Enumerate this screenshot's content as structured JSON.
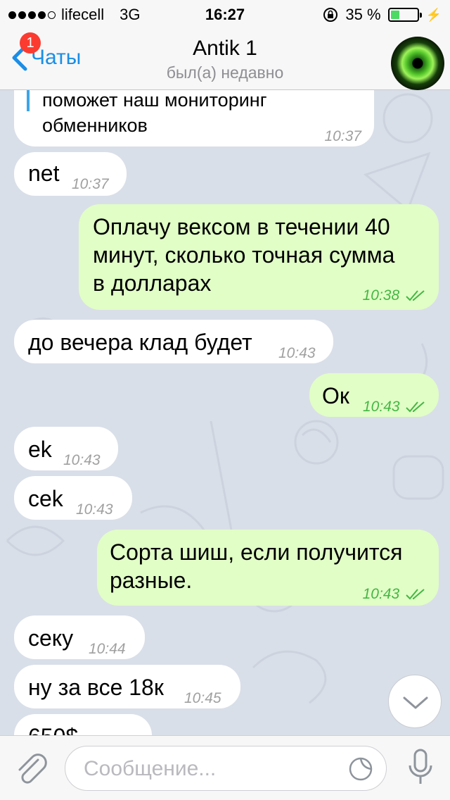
{
  "status_bar": {
    "carrier": "lifecell",
    "network": "3G",
    "time": "16:27",
    "battery": "35 %",
    "battery_level": 0.35,
    "signal_bars": 4
  },
  "nav": {
    "back_label": "Чаты",
    "badge_count": "1",
    "title": "Antik 1",
    "subtitle": "был(а) недавно"
  },
  "colors": {
    "accent": "#1a8ee6",
    "outgoing_bubble": "#e1fec6",
    "incoming_bubble": "#ffffff",
    "badge": "#fb3b30",
    "read_ticks": "#45b644"
  },
  "messages": [
    {
      "dir": "in",
      "lines": [
        "поможет наш мониторинг",
        "обменников"
      ],
      "time": "10:37",
      "quoted": true
    },
    {
      "dir": "in",
      "lines": [
        "net"
      ],
      "time": "10:37"
    },
    {
      "dir": "out",
      "lines": [
        "Оплачу вексом в течении 40",
        "минут, сколько точная сумма",
        "в долларах"
      ],
      "time": "10:38",
      "read": true
    },
    {
      "dir": "in",
      "lines": [
        "до вечера клад будет"
      ],
      "time": "10:43"
    },
    {
      "dir": "out",
      "lines": [
        "Ок"
      ],
      "time": "10:43",
      "read": true
    },
    {
      "dir": "in",
      "lines": [
        "ek"
      ],
      "time": "10:43"
    },
    {
      "dir": "in",
      "lines": [
        "cek"
      ],
      "time": "10:43"
    },
    {
      "dir": "out",
      "lines": [
        "Сорта шиш, если получится",
        "разные."
      ],
      "time": "10:43",
      "read": true
    },
    {
      "dir": "in",
      "lines": [
        "секу"
      ],
      "time": "10:44"
    },
    {
      "dir": "in",
      "lines": [
        "ну за все 18к"
      ],
      "time": "10:45"
    },
    {
      "dir": "in",
      "lines": [
        "650$"
      ],
      "time": ""
    }
  ],
  "input": {
    "placeholder": "Сообщение..."
  },
  "icons": {
    "back": "chevron-left-icon",
    "attach": "paperclip-icon",
    "sticker": "sticker-icon",
    "mic": "microphone-icon",
    "scroll": "chevron-down-icon",
    "read": "double-check-icon"
  }
}
